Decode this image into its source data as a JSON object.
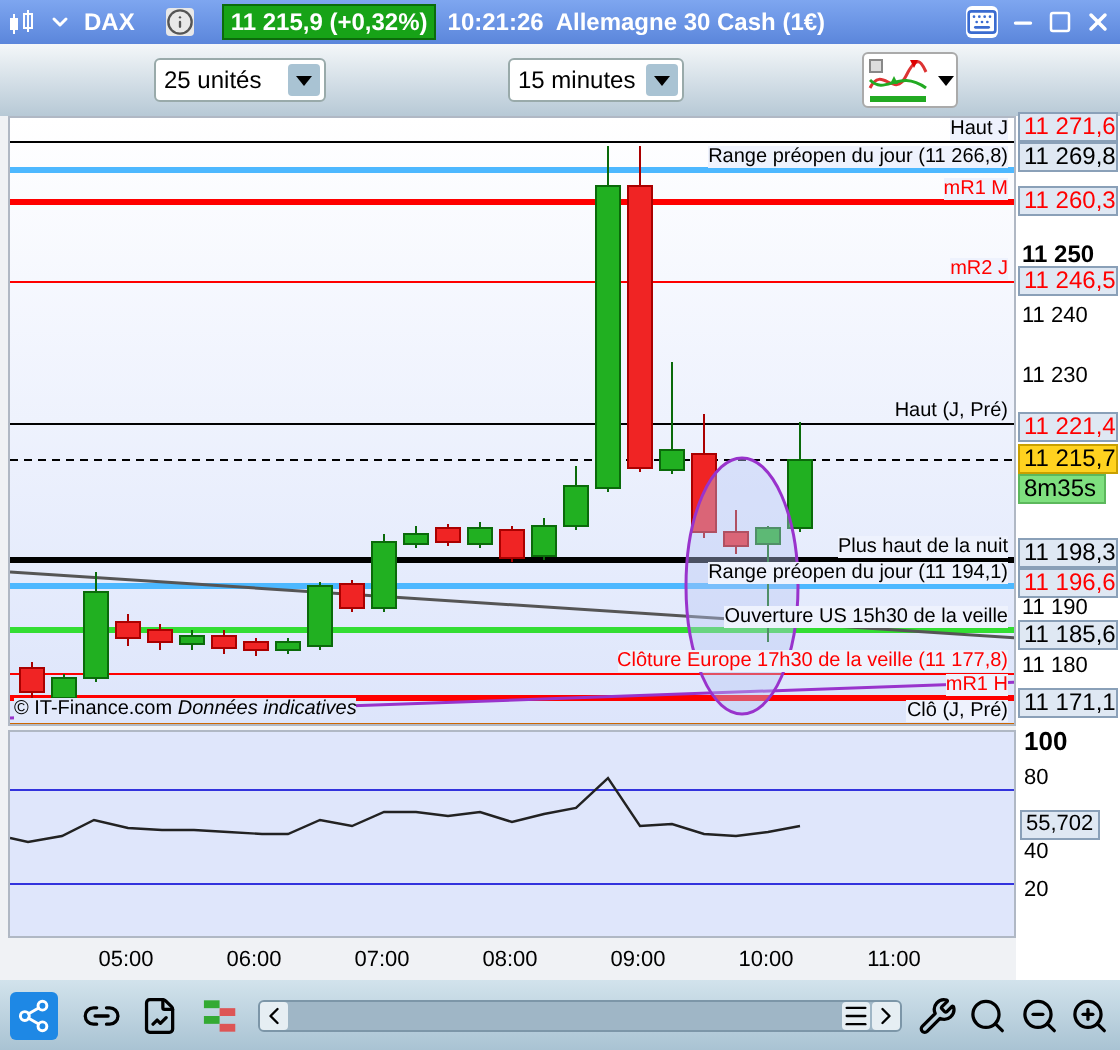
{
  "window": {
    "symbol": "DAX",
    "price": "11 215,9 (+0,32%)",
    "time": "10:21:26",
    "title": "Allemagne 30 Cash (1€)"
  },
  "toolbar": {
    "units": "25 unités",
    "period": "15 minutes"
  },
  "chart": {
    "levels": [
      {
        "label": "Haut J",
        "color": "#000000",
        "thick": false
      },
      {
        "label": "Range préopen du jour (11 266,8)",
        "color": "#4db8ff",
        "thick": true
      },
      {
        "label": "mR1 M",
        "color": "#ff0000",
        "thick": true
      },
      {
        "label": "mR2 J",
        "color": "#ff0000",
        "thick": false
      },
      {
        "label": "Haut (J, Pré)",
        "color": "#000000",
        "thick": false
      },
      {
        "label": "Plus haut de la nuit",
        "color": "#000000",
        "thick": true
      },
      {
        "label": "Range préopen du jour (11 194,1)",
        "color": "#4db8ff",
        "thick": true
      },
      {
        "label": "Ouverture US 15h30 de la veille",
        "color": "#33dd33",
        "thick": true
      },
      {
        "label": "Clôture Europe 17h30 de la veille (11 177,8)",
        "color": "#ff0000",
        "thick": false
      },
      {
        "label": "mR1 H",
        "color": "#ff0000",
        "thick": true
      },
      {
        "label": "Clô (J, Pré)",
        "color": "#cc6600",
        "thick": false
      }
    ],
    "price_ticks": [
      "11 250",
      "11 240",
      "11 230",
      "11 190",
      "11 180"
    ],
    "price_tags": [
      {
        "text": "11 271,6",
        "kind": "level",
        "color": "#ff0000"
      },
      {
        "text": "11 269,8",
        "kind": "level",
        "color": "#000000"
      },
      {
        "text": "11 260,3",
        "kind": "level",
        "color": "#ff0000"
      },
      {
        "text": "11 246,5",
        "kind": "level",
        "color": "#ff0000"
      },
      {
        "text": "11 221,4",
        "kind": "level",
        "color": "#ff0000"
      },
      {
        "text": "11 215,7",
        "kind": "last"
      },
      {
        "text": "8m35s",
        "kind": "timer"
      },
      {
        "text": "11 198,3",
        "kind": "level",
        "color": "#000000"
      },
      {
        "text": "11 196,6",
        "kind": "level",
        "color": "#ff0000"
      },
      {
        "text": "11 185,6",
        "kind": "level",
        "color": "#000000"
      },
      {
        "text": "11 171,1",
        "kind": "level",
        "color": "#000000"
      }
    ],
    "footer": "© IT-Finance.com *Données indicatives*"
  },
  "indicator": {
    "ticks": [
      "100",
      "80",
      "40",
      "20"
    ],
    "tag": "55,702"
  },
  "time_axis": [
    "05:00",
    "06:00",
    "07:00",
    "08:00",
    "09:00",
    "10:00",
    "11:00"
  ]
}
